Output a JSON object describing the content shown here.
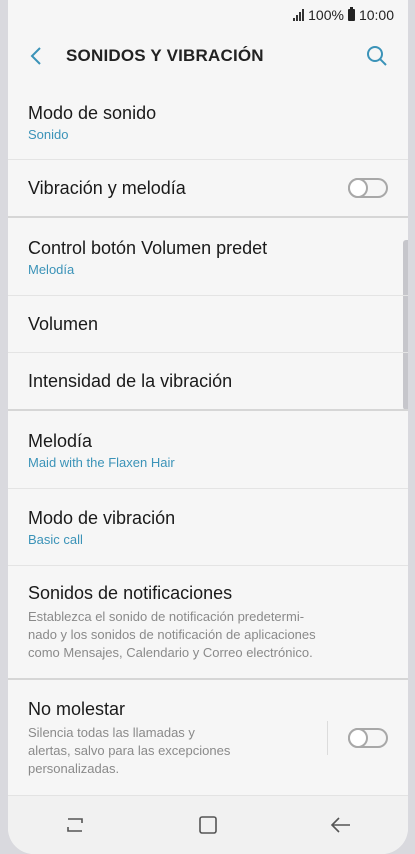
{
  "status": {
    "battery": "100%",
    "time": "10:00"
  },
  "header": {
    "title": "SONIDOS Y VIBRACIÓN"
  },
  "items": [
    {
      "label": "Modo de sonido",
      "sub": "Sonido"
    },
    {
      "label": "Vibración y melodía",
      "toggle": false
    },
    {
      "label": "Control botón Volumen predet",
      "sub": "Melodía"
    },
    {
      "label": "Volumen"
    },
    {
      "label": "Intensidad de la vibración"
    },
    {
      "label": "Melodía",
      "sub": "Maid with the Flaxen Hair"
    },
    {
      "label": "Modo de vibración",
      "sub": "Basic call"
    },
    {
      "label": "Sonidos de notificaciones",
      "desc": "Establezca el sonido de notificación predetermi-\nnado y los sonidos de notificación de aplicaciones\ncomo Mensajes, Calendario y Correo electrónico."
    },
    {
      "label": "No molestar",
      "desc": "Silencia todas las llamadas y\nalertas, salvo para las excepciones\npersonalizadas.",
      "toggle": false
    }
  ],
  "colors": {
    "accent": "#3b93b8",
    "background": "#f6f6f6"
  },
  "nav": [
    "recent-apps-icon",
    "home-icon",
    "back-icon"
  ]
}
